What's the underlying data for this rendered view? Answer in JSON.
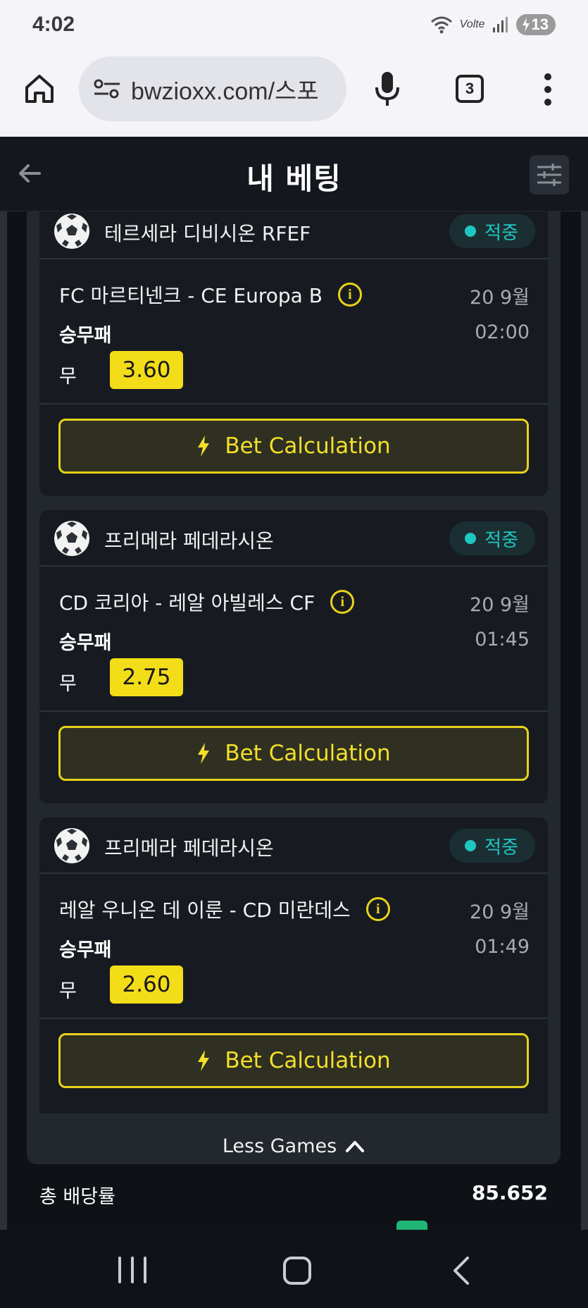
{
  "status_bar": {
    "time": "4:02",
    "volte": "Volte",
    "battery": "13"
  },
  "browser": {
    "url": "bwzioxx.com/스포",
    "tab_count": "3"
  },
  "header": {
    "title": "내 베팅"
  },
  "bets": [
    {
      "league": "테르세라 디비시온 RFEF",
      "status": "적중",
      "match": "FC 마르티넨크 - CE Europa B",
      "date": "20 9월",
      "market": "승무패",
      "time": "02:00",
      "pick": "무",
      "odds": "3.60",
      "action": "Bet Calculation"
    },
    {
      "league": "프리메라 페데라시온",
      "status": "적중",
      "match": "CD 코리아 - 레알 아빌레스 CF",
      "date": "20 9월",
      "market": "승무패",
      "time": "01:45",
      "pick": "무",
      "odds": "2.75",
      "action": "Bet Calculation"
    },
    {
      "league": "프리메라 페데라시온",
      "status": "적중",
      "match": "레알 우니온 데 이룬 - CD 미란데스",
      "date": "20 9월",
      "market": "승무패",
      "time": "01:49",
      "pick": "무",
      "odds": "2.60",
      "action": "Bet Calculation"
    }
  ],
  "less_games": "Less Games",
  "summary": {
    "total_odds_label": "총 배당률",
    "total_odds_value": "85.652"
  },
  "colors": {
    "accent_yellow": "#f3dd18",
    "status_teal": "#1fc7c2",
    "background": "#0e1116"
  },
  "icons": [
    "home-icon",
    "site-settings-icon",
    "mic-icon",
    "tabs-icon",
    "more-vert-icon",
    "back-arrow-icon",
    "filter-icon",
    "soccer-ball-icon",
    "info-icon",
    "lightning-icon",
    "chevron-up-icon"
  ]
}
